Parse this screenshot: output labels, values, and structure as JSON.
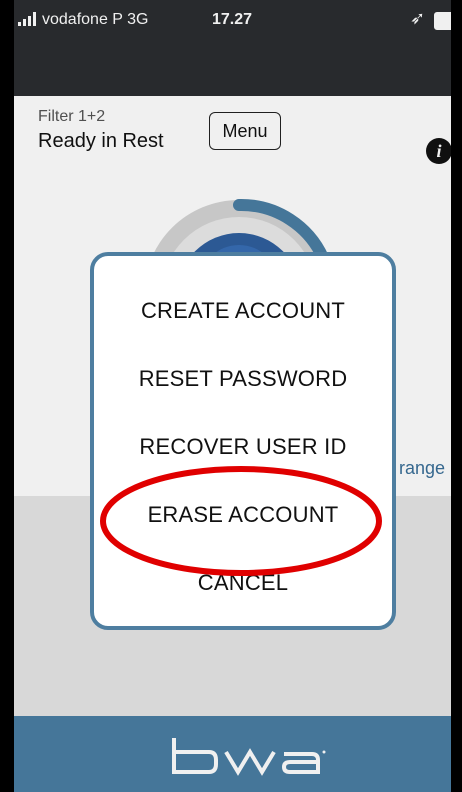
{
  "status_bar": {
    "carrier": "vodafone P  3G",
    "time": "17.27"
  },
  "app": {
    "filter_name": "Filter 1+2",
    "status": "Ready in Rest",
    "menu_button": "Menu",
    "info_icon": "i",
    "partial_link": "range"
  },
  "modal": {
    "items": [
      "CREATE ACCOUNT",
      "RESET PASSWORD",
      "RECOVER USER ID",
      "ERASE ACCOUNT",
      "CANCEL"
    ],
    "highlighted_item": "ERASE ACCOUNT",
    "border_color": "#4e7ea0",
    "highlight_color": "#e00000"
  },
  "footer": {
    "brand": "bwa",
    "background": "#4a7ea3"
  },
  "icons": [
    "signal-icon",
    "location-arrow-icon",
    "battery-icon",
    "info-icon",
    "gauge-icon",
    "bwa-logo"
  ]
}
